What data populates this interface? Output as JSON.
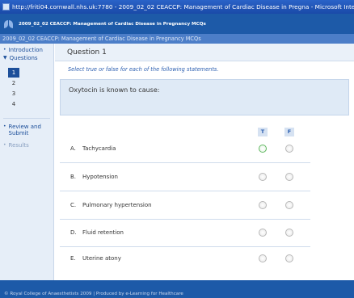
{
  "window": {
    "title": "http://friti04.cornwall.nhs.uk:7780 - 2009_02_02 CEACCP: Management of Cardiac Disease in Pregna - Microsoft Internet Ex"
  },
  "app_header": {
    "title": "2009_02_02 CEACCP: Management of Cardiac Disease in Pregnancy MCQs"
  },
  "sub_header": {
    "title": "2009_02_02 CEACCP: Management of Cardiac Disease in Pregnancy MCQs"
  },
  "sidebar": {
    "introduction": "Introduction",
    "questions": "Questions",
    "question_numbers": [
      "1",
      "2",
      "3",
      "4"
    ],
    "active_question": "1",
    "review_submit": "Review and Submit",
    "results": "Results"
  },
  "question": {
    "title": "Question 1",
    "instruction": "Select true or false for each of the following statements.",
    "stem": "Oxytocin is known to cause:",
    "true_label": "T",
    "false_label": "F",
    "options": [
      {
        "letter": "A.",
        "text": "Tachycardia"
      },
      {
        "letter": "B.",
        "text": "Hypotension"
      },
      {
        "letter": "C.",
        "text": "Pulmonary hypertension"
      },
      {
        "letter": "D.",
        "text": "Fluid retention"
      },
      {
        "letter": "E.",
        "text": "Uterine atony"
      }
    ]
  },
  "footer": {
    "text": "© Royal College of Anaesthetists 2009 | Produced by e-Learning for Healthcare"
  },
  "colors": {
    "header_blue": "#1d5aa8",
    "accent_blue": "#2c5fb0",
    "panel_blue": "#dfeaf6"
  },
  "icons": [
    "browser-icon",
    "college-logo-icon",
    "radio-icon"
  ]
}
